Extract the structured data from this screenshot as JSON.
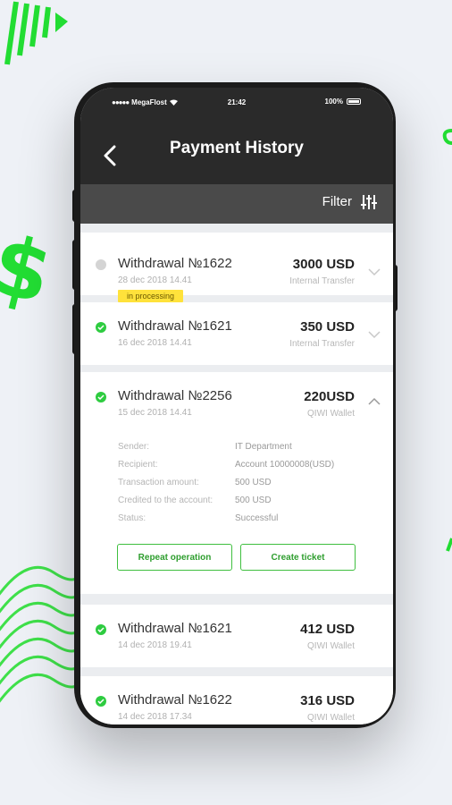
{
  "status_bar": {
    "carrier": "MegaFlost",
    "time": "21:42",
    "battery": "100%"
  },
  "header": {
    "title": "Payment History"
  },
  "filter": {
    "label": "Filter"
  },
  "transactions": [
    {
      "title": "Withdrawal №1622",
      "date": "28 dec 2018  14.41",
      "amount": "3000 USD",
      "method": "Internal Transfer",
      "badge": "in processing",
      "status": "processing"
    },
    {
      "title": "Withdrawal №1621",
      "date": "16 dec 2018  14.41",
      "amount": "350 USD",
      "method": "Internal Transfer",
      "status": "success"
    },
    {
      "title": "Withdrawal №2256",
      "date": "15 dec 2018  14.41",
      "amount": "220USD",
      "method": "QIWI Wallet",
      "status": "success",
      "expanded": true,
      "details": [
        {
          "key": "Sender:",
          "value": "IT Department"
        },
        {
          "key": "Recipient:",
          "value": "Account 10000008(USD)"
        },
        {
          "key": "Transaction amount:",
          "value": "500 USD"
        },
        {
          "key": "Credited to the account:",
          "value": "500 USD"
        },
        {
          "key": "Status:",
          "value": "Successful"
        }
      ],
      "actions": {
        "repeat": "Repeat operation",
        "ticket": "Create ticket"
      }
    },
    {
      "title": "Withdrawal №1621",
      "date": "14 dec 2018  19.41",
      "amount": "412 USD",
      "method": "QIWI Wallet",
      "status": "success"
    },
    {
      "title": "Withdrawal №1622",
      "date": "14 dec 2018  17.34",
      "amount": "316 USD",
      "method": "QIWI Wallet",
      "status": "success"
    }
  ],
  "colors": {
    "accent": "#2ecc40",
    "pending": "#cfcfcf",
    "badge": "#ffe23b",
    "header": "#2a2a2a",
    "filter_bar": "#4a4a4a"
  }
}
